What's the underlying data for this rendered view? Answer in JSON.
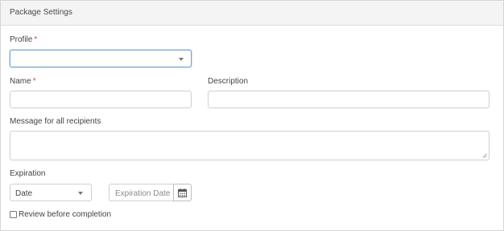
{
  "panel": {
    "title": "Package Settings"
  },
  "profile": {
    "label": "Profile",
    "required_mark": "*",
    "value": ""
  },
  "name": {
    "label": "Name",
    "required_mark": "*",
    "value": ""
  },
  "description": {
    "label": "Description",
    "value": ""
  },
  "message": {
    "label": "Message for all recipients",
    "value": ""
  },
  "expiration": {
    "label": "Expiration",
    "type_value": "Date",
    "date_placeholder": "Expiration Date"
  },
  "review": {
    "label": "Review before completion",
    "checked": false
  },
  "icons": {
    "dropdown": "chevron-down-icon",
    "calendar": "calendar-icon",
    "resize": "resize-handle-icon"
  },
  "colors": {
    "required": "#e0443a",
    "focus_border": "#7aa7d6",
    "header_bg": "#f4f4f4"
  }
}
